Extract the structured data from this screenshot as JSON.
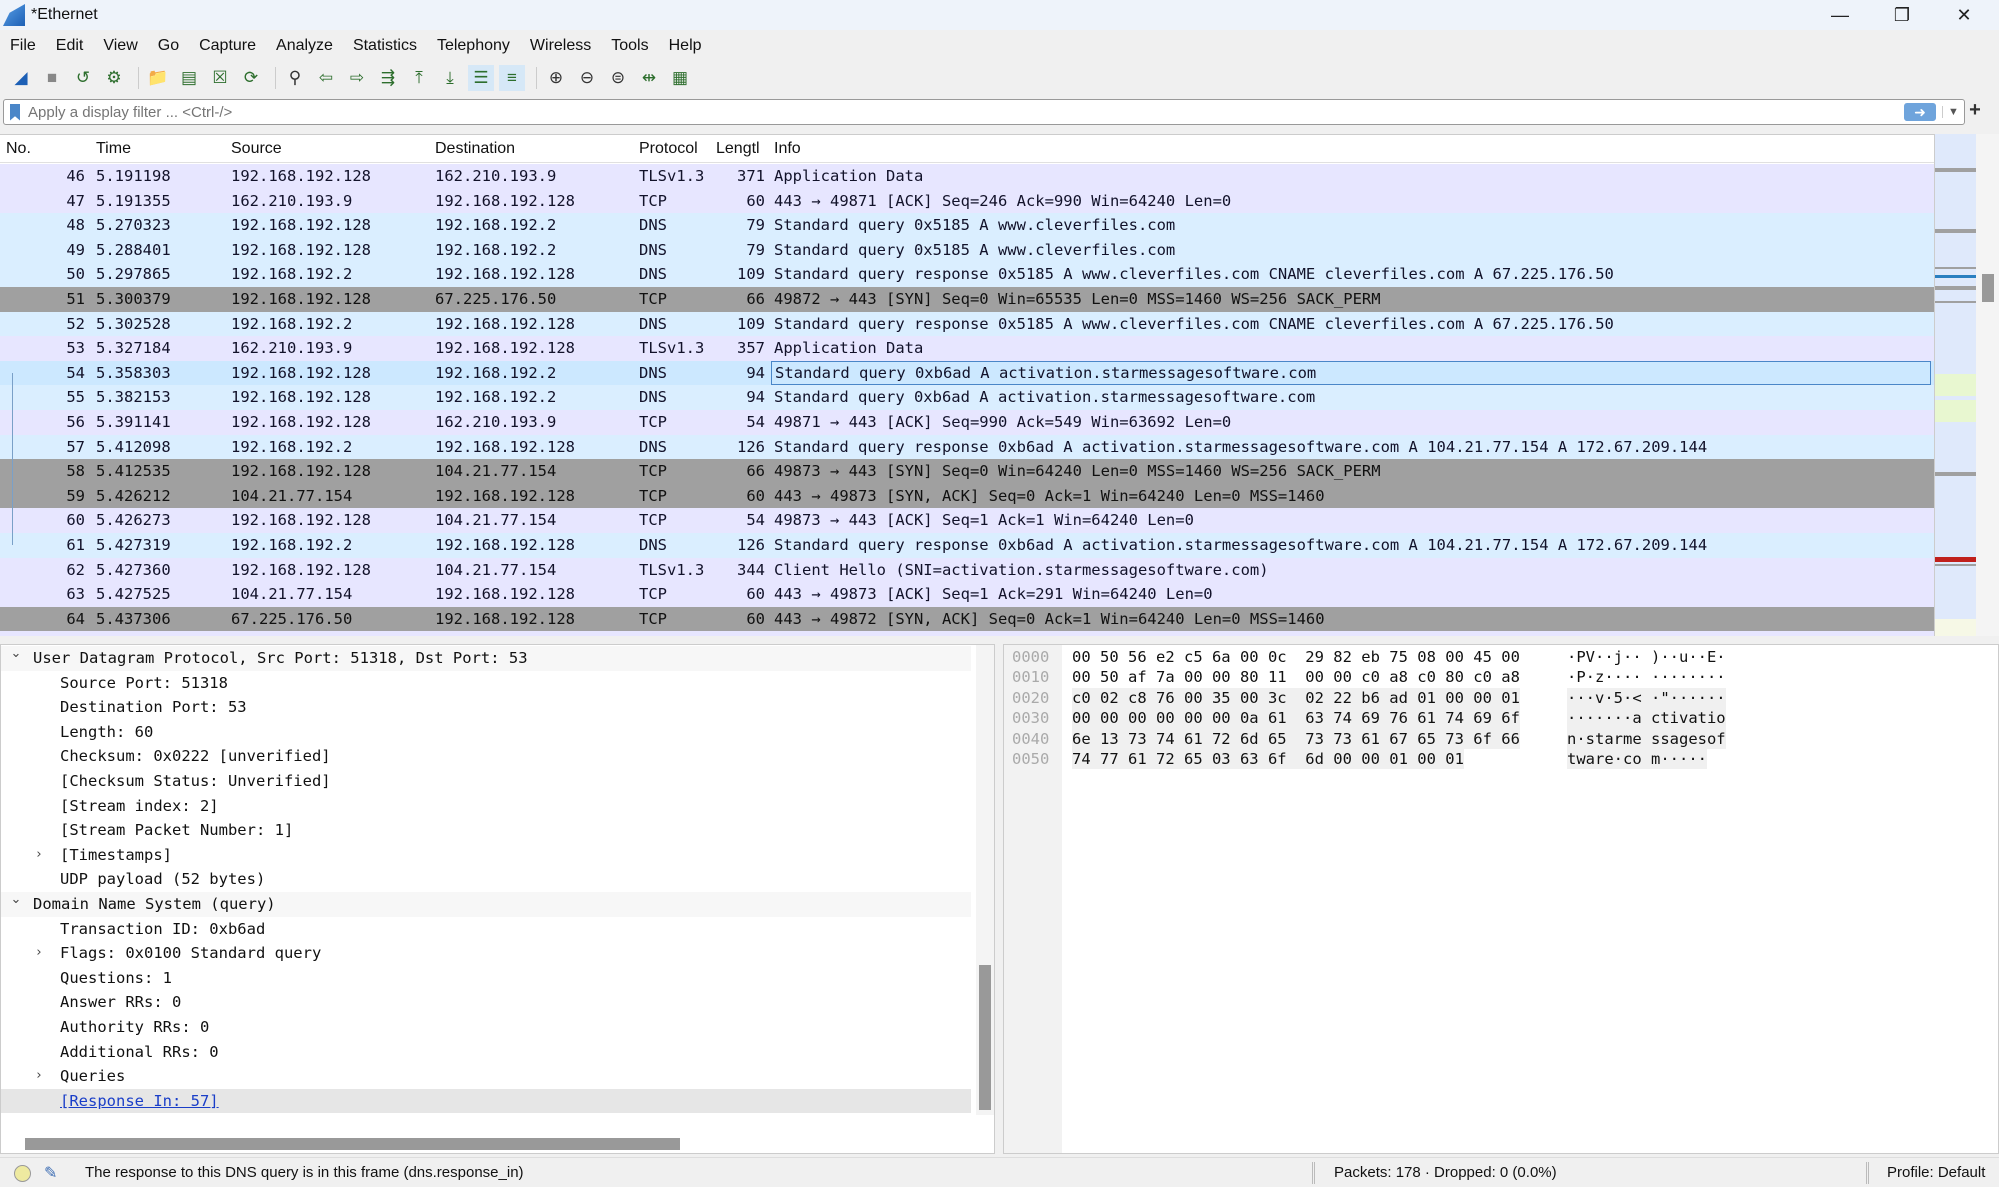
{
  "window": {
    "title": "*Ethernet",
    "controls": [
      "minimize",
      "restore",
      "close"
    ]
  },
  "menu": [
    "File",
    "Edit",
    "View",
    "Go",
    "Capture",
    "Analyze",
    "Statistics",
    "Telephony",
    "Wireless",
    "Tools",
    "Help"
  ],
  "toolbar": [
    "start-capture-icon",
    "stop-capture-icon",
    "restart-capture-icon",
    "capture-options-icon",
    "|",
    "open-file-icon",
    "save-file-icon",
    "close-file-icon",
    "reload-icon",
    "|",
    "find-packet-icon",
    "go-back-icon",
    "go-forward-icon",
    "go-to-packet-icon",
    "first-packet-icon",
    "last-packet-icon",
    "auto-scroll-icon",
    "colorize-icon",
    "|",
    "zoom-in-icon",
    "zoom-out-icon",
    "zoom-normal-icon",
    "resize-columns-icon",
    "layout-icon"
  ],
  "filter": {
    "placeholder": "Apply a display filter ... <Ctrl-/>",
    "value": ""
  },
  "packet_list": {
    "columns": [
      "No.",
      "Time",
      "Source",
      "Destination",
      "Protocol",
      "Lengtl",
      "Info"
    ],
    "selected": "54",
    "colors": {
      "tcp": "#e7e6ff",
      "udp": "#daeeff",
      "syn": "#a0a0a0",
      "selected": "#cce8ff"
    },
    "rows": [
      {
        "no": "46",
        "time": "5.191198",
        "src": "192.168.192.128",
        "dst": "162.210.193.9",
        "proto": "TLSv1.3",
        "len": "371",
        "info": "Application Data",
        "color": "tcp"
      },
      {
        "no": "47",
        "time": "5.191355",
        "src": "162.210.193.9",
        "dst": "192.168.192.128",
        "proto": "TCP",
        "len": "60",
        "info": "443 → 49871 [ACK] Seq=246 Ack=990 Win=64240 Len=0",
        "color": "tcp"
      },
      {
        "no": "48",
        "time": "5.270323",
        "src": "192.168.192.128",
        "dst": "192.168.192.2",
        "proto": "DNS",
        "len": "79",
        "info": "Standard query 0x5185 A www.cleverfiles.com",
        "color": "udp"
      },
      {
        "no": "49",
        "time": "5.288401",
        "src": "192.168.192.128",
        "dst": "192.168.192.2",
        "proto": "DNS",
        "len": "79",
        "info": "Standard query 0x5185 A www.cleverfiles.com",
        "color": "udp"
      },
      {
        "no": "50",
        "time": "5.297865",
        "src": "192.168.192.2",
        "dst": "192.168.192.128",
        "proto": "DNS",
        "len": "109",
        "info": "Standard query response 0x5185 A www.cleverfiles.com CNAME cleverfiles.com A 67.225.176.50",
        "color": "udp"
      },
      {
        "no": "51",
        "time": "5.300379",
        "src": "192.168.192.128",
        "dst": "67.225.176.50",
        "proto": "TCP",
        "len": "66",
        "info": "49872 → 443 [SYN] Seq=0 Win=65535 Len=0 MSS=1460 WS=256 SACK_PERM",
        "color": "syn"
      },
      {
        "no": "52",
        "time": "5.302528",
        "src": "192.168.192.2",
        "dst": "192.168.192.128",
        "proto": "DNS",
        "len": "109",
        "info": "Standard query response 0x5185 A www.cleverfiles.com CNAME cleverfiles.com A 67.225.176.50",
        "color": "udp"
      },
      {
        "no": "53",
        "time": "5.327184",
        "src": "162.210.193.9",
        "dst": "192.168.192.128",
        "proto": "TLSv1.3",
        "len": "357",
        "info": "Application Data",
        "color": "tcp"
      },
      {
        "no": "54",
        "time": "5.358303",
        "src": "192.168.192.128",
        "dst": "192.168.192.2",
        "proto": "DNS",
        "len": "94",
        "info": "Standard query 0xb6ad A activation.starmessagesoftware.com",
        "color": "selected"
      },
      {
        "no": "55",
        "time": "5.382153",
        "src": "192.168.192.128",
        "dst": "192.168.192.2",
        "proto": "DNS",
        "len": "94",
        "info": "Standard query 0xb6ad A activation.starmessagesoftware.com",
        "color": "udp"
      },
      {
        "no": "56",
        "time": "5.391141",
        "src": "192.168.192.128",
        "dst": "162.210.193.9",
        "proto": "TCP",
        "len": "54",
        "info": "49871 → 443 [ACK] Seq=990 Ack=549 Win=63692 Len=0",
        "color": "tcp"
      },
      {
        "no": "57",
        "time": "5.412098",
        "src": "192.168.192.2",
        "dst": "192.168.192.128",
        "proto": "DNS",
        "len": "126",
        "info": "Standard query response 0xb6ad A activation.starmessagesoftware.com A 104.21.77.154 A 172.67.209.144",
        "color": "udp"
      },
      {
        "no": "58",
        "time": "5.412535",
        "src": "192.168.192.128",
        "dst": "104.21.77.154",
        "proto": "TCP",
        "len": "66",
        "info": "49873 → 443 [SYN] Seq=0 Win=64240 Len=0 MSS=1460 WS=256 SACK_PERM",
        "color": "syn"
      },
      {
        "no": "59",
        "time": "5.426212",
        "src": "104.21.77.154",
        "dst": "192.168.192.128",
        "proto": "TCP",
        "len": "60",
        "info": "443 → 49873 [SYN, ACK] Seq=0 Ack=1 Win=64240 Len=0 MSS=1460",
        "color": "syn"
      },
      {
        "no": "60",
        "time": "5.426273",
        "src": "192.168.192.128",
        "dst": "104.21.77.154",
        "proto": "TCP",
        "len": "54",
        "info": "49873 → 443 [ACK] Seq=1 Ack=1 Win=64240 Len=0",
        "color": "tcp"
      },
      {
        "no": "61",
        "time": "5.427319",
        "src": "192.168.192.2",
        "dst": "192.168.192.128",
        "proto": "DNS",
        "len": "126",
        "info": "Standard query response 0xb6ad A activation.starmessagesoftware.com A 104.21.77.154 A 172.67.209.144",
        "color": "udp"
      },
      {
        "no": "62",
        "time": "5.427360",
        "src": "192.168.192.128",
        "dst": "104.21.77.154",
        "proto": "TLSv1.3",
        "len": "344",
        "info": "Client Hello (SNI=activation.starmessagesoftware.com)",
        "color": "tcp"
      },
      {
        "no": "63",
        "time": "5.427525",
        "src": "104.21.77.154",
        "dst": "192.168.192.128",
        "proto": "TCP",
        "len": "60",
        "info": "443 → 49873 [ACK] Seq=1 Ack=291 Win=64240 Len=0",
        "color": "tcp"
      },
      {
        "no": "64",
        "time": "5.437306",
        "src": "67.225.176.50",
        "dst": "192.168.192.128",
        "proto": "TCP",
        "len": "60",
        "info": "443 → 49872 [SYN, ACK] Seq=0 Ack=1 Win=64240 Len=0 MSS=1460",
        "color": "syn"
      }
    ]
  },
  "details": [
    {
      "level": 0,
      "exp": "open",
      "text": "User Datagram Protocol, Src Port: 51318, Dst Port: 53"
    },
    {
      "level": 1,
      "exp": "",
      "text": "Source Port: 51318"
    },
    {
      "level": 1,
      "exp": "",
      "text": "Destination Port: 53"
    },
    {
      "level": 1,
      "exp": "",
      "text": "Length: 60"
    },
    {
      "level": 1,
      "exp": "",
      "text": "Checksum: 0x0222 [unverified]"
    },
    {
      "level": 1,
      "exp": "",
      "text": "[Checksum Status: Unverified]"
    },
    {
      "level": 1,
      "exp": "",
      "text": "[Stream index: 2]"
    },
    {
      "level": 1,
      "exp": "",
      "text": "[Stream Packet Number: 1]"
    },
    {
      "level": 1,
      "exp": "closed",
      "text": "[Timestamps]"
    },
    {
      "level": 1,
      "exp": "",
      "text": "UDP payload (52 bytes)"
    },
    {
      "level": 0,
      "exp": "open",
      "text": "Domain Name System (query)"
    },
    {
      "level": 1,
      "exp": "",
      "text": "Transaction ID: 0xb6ad"
    },
    {
      "level": 1,
      "exp": "closed",
      "text": "Flags: 0x0100 Standard query"
    },
    {
      "level": 1,
      "exp": "",
      "text": "Questions: 1"
    },
    {
      "level": 1,
      "exp": "",
      "text": "Answer RRs: 0"
    },
    {
      "level": 1,
      "exp": "",
      "text": "Authority RRs: 0"
    },
    {
      "level": 1,
      "exp": "",
      "text": "Additional RRs: 0"
    },
    {
      "level": 1,
      "exp": "closed",
      "text": "Queries"
    },
    {
      "level": 1,
      "exp": "",
      "text": "[Response In: 57]",
      "link": true,
      "selected": true
    }
  ],
  "hex": [
    {
      "offset": "0000",
      "bytes": "00 50 56 e2 c5 6a 00 0c  29 82 eb 75 08 00 45 00",
      "ascii": "·PV··j·· )··u··E·"
    },
    {
      "offset": "0010",
      "bytes": "00 50 af 7a 00 00 80 11  00 00 c0 a8 c0 80 c0 a8",
      "ascii": "·P·z···· ········"
    },
    {
      "offset": "0020",
      "bytes": "c0 02 c8 76 00 35 00 3c  02 22 b6 ad 01 00 00 01",
      "ascii": "···v·5·< ·\"······"
    },
    {
      "offset": "0030",
      "bytes": "00 00 00 00 00 00 0a 61  63 74 69 76 61 74 69 6f",
      "ascii": "·······a ctivatio"
    },
    {
      "offset": "0040",
      "bytes": "6e 13 73 74 61 72 6d 65  73 73 61 67 65 73 6f 66",
      "ascii": "n·starme ssagesof"
    },
    {
      "offset": "0050",
      "bytes": "74 77 61 72 65 03 63 6f  6d 00 00 01 00 01",
      "ascii": "tware·co m·····"
    }
  ],
  "status": {
    "message": "The response to this DNS query is in this frame (dns.response_in)",
    "packets": "Packets: 178 · Dropped: 0 (0.0%)",
    "profile": "Profile: Default"
  }
}
